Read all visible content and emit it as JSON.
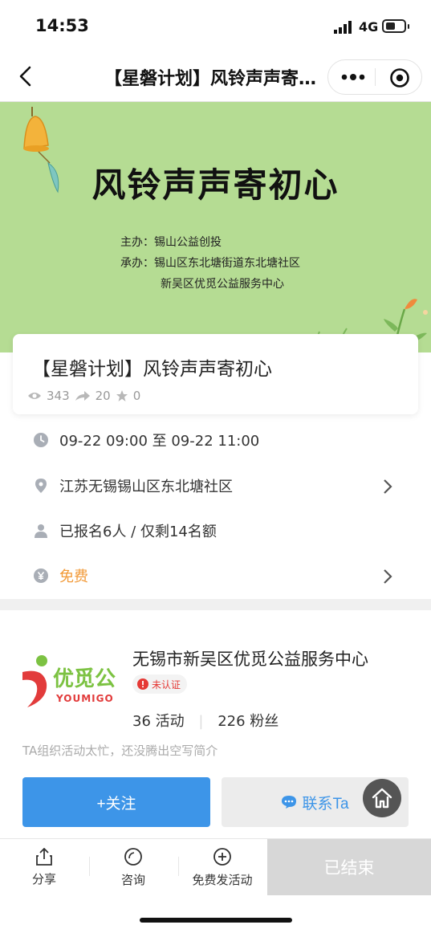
{
  "status_bar": {
    "time": "14:53",
    "network": "4G"
  },
  "nav": {
    "title": "【星磐计划】风铃声声寄初心…",
    "more_icon": "more-dots-icon",
    "target_icon": "target-icon"
  },
  "banner": {
    "title": "风铃声声寄初心",
    "host_line": "主办：锡山公益创投",
    "organizer_line1": "承办：锡山区东北塘街道东北塘社区",
    "organizer_line2": "新吴区优觅公益服务中心",
    "background_color": "#b5dc93"
  },
  "event": {
    "title": "【星磐计划】风铃声声寄初心",
    "views": "343",
    "shares": "20",
    "favorites": "0"
  },
  "info_rows": {
    "time": "09-22 09:00 至 09-22 11:00",
    "location": "江苏无锡锡山区东北塘社区",
    "enrollment": "已报名6人 / 仅剩14名额",
    "price": "免费",
    "price_color": "#f29a38"
  },
  "organizer": {
    "name": "无锡市新吴区优觅公益服务中心",
    "badge": "未认证",
    "activities": "36 活动",
    "fans": "226 粉丝",
    "description": "TA组织活动太忙，还没腾出空写简介",
    "logo_text": "优觅公",
    "logo_subtext": "YOUMIGO"
  },
  "actions": {
    "follow_label": "+关注",
    "contact_label": "联系Ta",
    "accent_color": "#3d95e8"
  },
  "bottom_bar": {
    "share": "分享",
    "consult": "咨询",
    "publish": "免费发活动",
    "ended": "已结束"
  }
}
